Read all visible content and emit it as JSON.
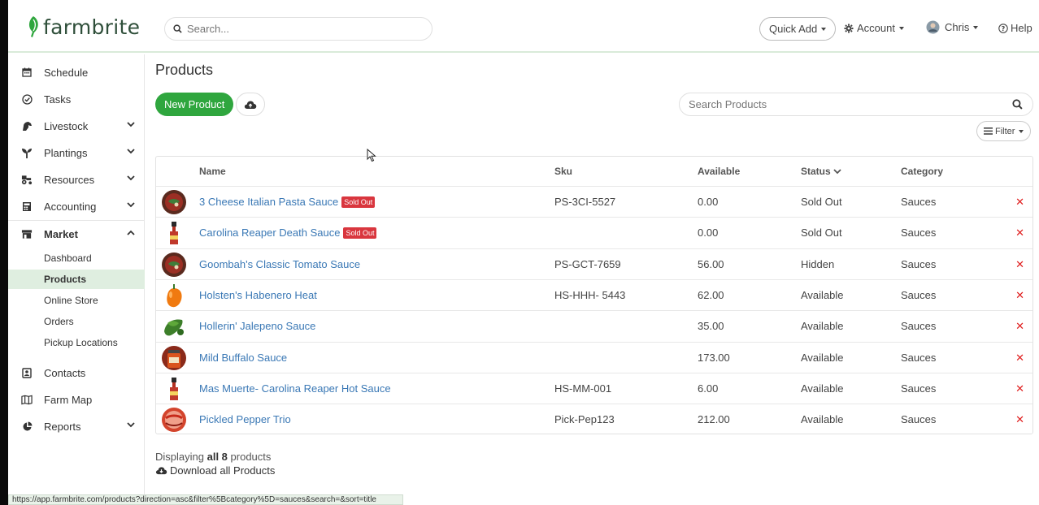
{
  "header": {
    "logo_text": "farmbrite",
    "search_placeholder": "Search...",
    "quick_add": "Quick Add",
    "account": "Account",
    "user": "Chris",
    "help": "Help"
  },
  "sidebar": {
    "items": [
      {
        "label": "Schedule",
        "icon": "calendar-icon"
      },
      {
        "label": "Tasks",
        "icon": "check-circle-icon"
      },
      {
        "label": "Livestock",
        "icon": "horse-icon",
        "expandable": true
      },
      {
        "label": "Plantings",
        "icon": "seedling-icon",
        "expandable": true
      },
      {
        "label": "Resources",
        "icon": "tractor-icon",
        "expandable": true
      },
      {
        "label": "Accounting",
        "icon": "calculator-icon",
        "expandable": true
      },
      {
        "label": "Market",
        "icon": "store-icon",
        "expandable": true,
        "expanded": true
      }
    ],
    "market_sub": [
      "Dashboard",
      "Products",
      "Online Store",
      "Orders",
      "Pickup Locations"
    ],
    "items_after": [
      {
        "label": "Contacts",
        "icon": "contact-card-icon"
      },
      {
        "label": "Farm Map",
        "icon": "map-icon"
      },
      {
        "label": "Reports",
        "icon": "pie-chart-icon",
        "expandable": true
      }
    ]
  },
  "main": {
    "title": "Products",
    "new_product": "New Product",
    "search_placeholder": "Search Products",
    "filter": "Filter",
    "columns": {
      "name": "Name",
      "sku": "Sku",
      "available": "Available",
      "status": "Status",
      "category": "Category"
    },
    "sold_out_badge": "Sold Out",
    "rows": [
      {
        "name": "3 Cheese Italian Pasta Sauce",
        "sold_out": true,
        "sku": "PS-3CI-5527",
        "available": "0.00",
        "status": "Sold Out",
        "category": "Sauces",
        "thumb": "bowl"
      },
      {
        "name": "Carolina Reaper Death Sauce",
        "sold_out": true,
        "sku": "",
        "available": "0.00",
        "status": "Sold Out",
        "category": "Sauces",
        "thumb": "bottle"
      },
      {
        "name": "Goombah's Classic Tomato Sauce",
        "sold_out": false,
        "sku": "PS-GCT-7659",
        "available": "56.00",
        "status": "Hidden",
        "category": "Sauces",
        "thumb": "bowl"
      },
      {
        "name": "Holsten's Habenero Heat",
        "sold_out": false,
        "sku": "HS-HHH- 5443",
        "available": "62.00",
        "status": "Available",
        "category": "Sauces",
        "thumb": "pepper"
      },
      {
        "name": "Hollerin' Jalepeno Sauce",
        "sold_out": false,
        "sku": "",
        "available": "35.00",
        "status": "Available",
        "category": "Sauces",
        "thumb": "jalapeno"
      },
      {
        "name": "Mild Buffalo Sauce",
        "sold_out": false,
        "sku": "",
        "available": "173.00",
        "status": "Available",
        "category": "Sauces",
        "thumb": "jar"
      },
      {
        "name": "Mas Muerte- Carolina Reaper Hot Sauce",
        "sold_out": false,
        "sku": "HS-MM-001",
        "available": "6.00",
        "status": "Available",
        "category": "Sauces",
        "thumb": "bottle"
      },
      {
        "name": "Pickled Pepper Trio",
        "sold_out": false,
        "sku": "Pick-Pep123",
        "available": "212.00",
        "status": "Available",
        "category": "Sauces",
        "thumb": "pickled"
      }
    ],
    "display_prefix": "Displaying",
    "display_all": "all 8",
    "display_suffix": "products",
    "download_all": "Download all Products"
  },
  "statusbar": {
    "url": "https://app.farmbrite.com/products?direction=asc&filter%5Bcategory%5D=sauces&search=&sort=title"
  },
  "colors": {
    "brand_green": "#2fa63e",
    "link_blue": "#3a78b5",
    "danger_red": "#d9363e",
    "active_nav": "#dfeee0"
  }
}
